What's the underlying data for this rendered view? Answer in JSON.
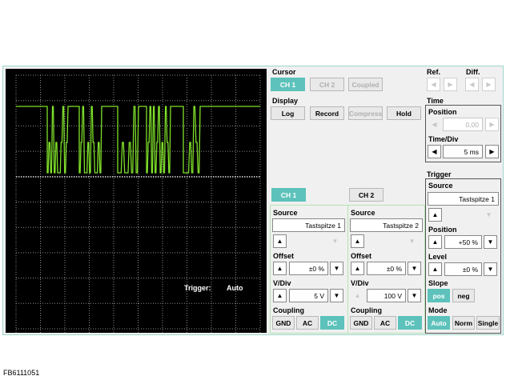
{
  "scope": {
    "trigger_label": "Trigger:",
    "trigger_mode": "Auto",
    "trace_color": "#7fe02a"
  },
  "cursor": {
    "title": "Cursor",
    "ch1": "CH 1",
    "ch2": "CH 2",
    "coupled": "Coupled"
  },
  "refdiff": {
    "ref": "Ref.",
    "diff": "Diff."
  },
  "display": {
    "title": "Display",
    "log": "Log",
    "record": "Record",
    "compress": "Compress",
    "hold": "Hold"
  },
  "time": {
    "title": "Time",
    "position_label": "Position",
    "position_value": "0,00",
    "timediv_label": "Time/Div",
    "timediv_value": "5 ms"
  },
  "channels": {
    "ch1_tab": "CH 1",
    "ch2_tab": "CH 2",
    "ch1": {
      "source_label": "Source",
      "source_value": "Tastspitze 1",
      "offset_label": "Offset",
      "offset_value": "±0 %",
      "vdiv_label": "V/Div",
      "vdiv_value": "5 V",
      "coupling_label": "Coupling",
      "gnd": "GND",
      "ac": "AC",
      "dc": "DC"
    },
    "ch2": {
      "source_label": "Source",
      "source_value": "Tastspitze 2",
      "offset_label": "Offset",
      "offset_value": "±0 %",
      "vdiv_label": "V/Div",
      "vdiv_value": "100 V",
      "coupling_label": "Coupling",
      "gnd": "GND",
      "ac": "AC",
      "dc": "DC"
    }
  },
  "trigger": {
    "title": "Trigger",
    "source_label": "Source",
    "source_value": "Tastspitze 1",
    "position_label": "Position",
    "position_value": "+50 %",
    "level_label": "Level",
    "level_value": "±0 %",
    "slope_label": "Slope",
    "pos": "pos",
    "neg": "neg",
    "mode_label": "Mode",
    "auto": "Auto",
    "norm": "Norm",
    "single": "Single"
  },
  "icons": {
    "up": "▲",
    "down": "▼",
    "left": "◀",
    "right": "▶"
  },
  "colors": {
    "accent": "#5cc2bb",
    "grid": "#9a9a9a"
  },
  "figure_code": "FB6111051"
}
